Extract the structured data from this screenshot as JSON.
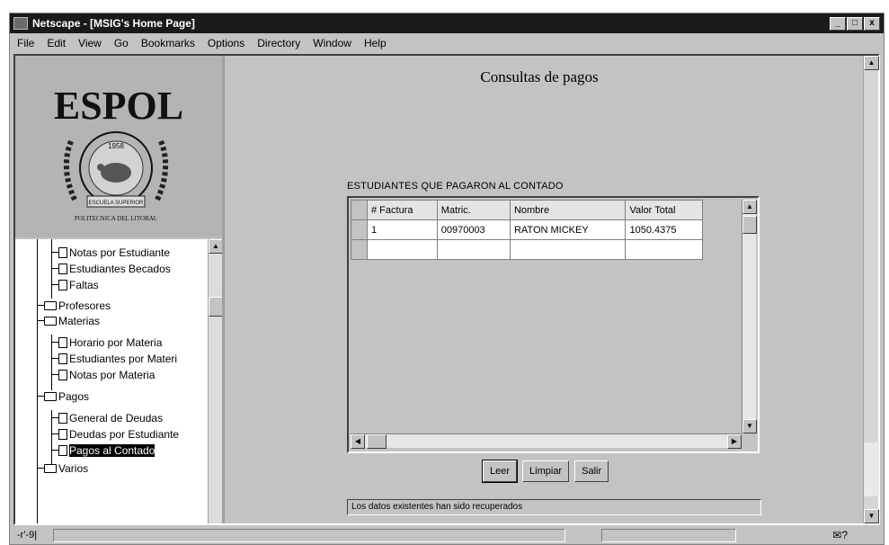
{
  "window": {
    "title": "Netscape - [MSIG's Home Page]",
    "controls": [
      "_",
      "□",
      "x"
    ]
  },
  "menubar": {
    "items": [
      "File",
      "Edit",
      "View",
      "Go",
      "Bookmarks",
      "Options",
      "Directory",
      "Window",
      "Help"
    ]
  },
  "logo": {
    "text": "ESPOL",
    "year": "1958",
    "band_text": "ESCUELA SUPERIOR",
    "footer": "POLITECNICA DEL LITORAL"
  },
  "tree": {
    "items": [
      {
        "label": "Notas por Estudiante",
        "type": "doc"
      },
      {
        "label": "Estudiantes Becados",
        "type": "doc"
      },
      {
        "label": "Faltas",
        "type": "doc"
      },
      {
        "label": "Profesores",
        "type": "folder"
      },
      {
        "label": "Materias",
        "type": "folder"
      },
      {
        "label": "Horario por Materia",
        "type": "doc"
      },
      {
        "label": "Estudiantes por Materi",
        "type": "doc"
      },
      {
        "label": "Notas por Materia",
        "type": "doc"
      },
      {
        "label": "Pagos",
        "type": "folder"
      },
      {
        "label": "General de Deudas",
        "type": "doc"
      },
      {
        "label": "Deudas por Estudiante",
        "type": "doc"
      },
      {
        "label": "Pagos al Contado",
        "type": "doc",
        "selected": true
      },
      {
        "label": "Varios",
        "type": "folder"
      }
    ]
  },
  "main": {
    "heading": "Consultas de pagos",
    "grid_label": "ESTUDIANTES QUE PAGARON AL CONTADO",
    "columns": [
      "# Factura",
      "Matric.",
      "Nombre",
      "Valor Total"
    ],
    "rows": [
      [
        "1",
        "00970003",
        "RATON MICKEY",
        "1050.4375"
      ]
    ],
    "buttons": {
      "leer": "Leer",
      "limpiar": "Limpiar",
      "salir": "Salir"
    },
    "status_message": "Los datos existentes han sido recuperados"
  },
  "statusbar": {
    "left_icon": "-r'-9|",
    "mail": "✉?"
  }
}
